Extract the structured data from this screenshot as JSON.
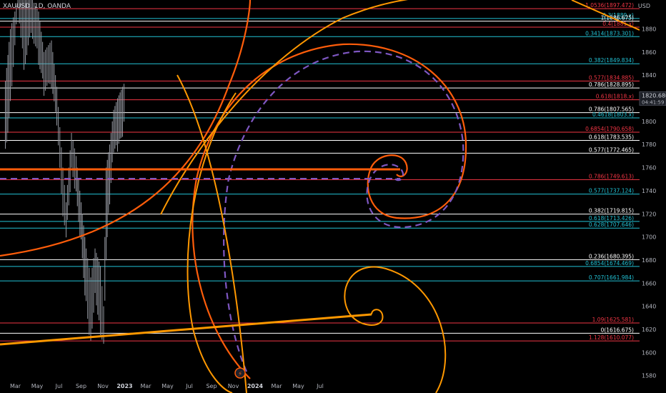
{
  "header": {
    "symbol": "XAUUSD, 1D, OANDA",
    "currency": "USD"
  },
  "price_tag": {
    "value": "1820.680",
    "countdown": "04:41:59"
  },
  "chart_data": {
    "type": "line",
    "title": "",
    "xlabel": "",
    "ylabel": "",
    "ylim": [
      1565,
      1905
    ],
    "y_ticks": [
      1580,
      1600,
      1620,
      1640,
      1660,
      1680,
      1700,
      1720,
      1740,
      1760,
      1780,
      1800,
      1820,
      1840,
      1860,
      1880
    ],
    "x_ticks": [
      "Mar",
      "May",
      "Jul",
      "Sep",
      "Nov",
      "2023",
      "Mar",
      "May",
      "Jul",
      "Sep",
      "Nov",
      "2024",
      "Mar",
      "May",
      "Jul"
    ],
    "colors": {
      "red": "#f23645",
      "cyan": "#22c3d6",
      "white": "#ffffff",
      "orange": "#ff9800",
      "deep_orange": "#ff5d0a",
      "purple": "#7e57c2"
    },
    "fib_levels": [
      {
        "text": "1.0536(1897.472)",
        "price": 1897.472,
        "color": "red"
      },
      {
        "text": "0.3(1889.x)",
        "price": 1889.0,
        "color": "cyan"
      },
      {
        "text": "1(1886.675)",
        "price": 1886.675,
        "color": "white"
      },
      {
        "text": "0.4(1881.x)",
        "price": 1881.5,
        "color": "red"
      },
      {
        "text": "0.3414(1873.301)",
        "price": 1873.301,
        "color": "cyan"
      },
      {
        "text": "0.382(1849.834)",
        "price": 1849.834,
        "color": "cyan"
      },
      {
        "text": "0.577(1834.885)",
        "price": 1834.885,
        "color": "red"
      },
      {
        "text": "0.786(1828.895)",
        "price": 1828.895,
        "color": "white"
      },
      {
        "text": "0.618(1818.x)",
        "price": 1818.7,
        "color": "red"
      },
      {
        "text": "0.786(1807.565)",
        "price": 1807.565,
        "color": "white"
      },
      {
        "text": "0.4618(1803.x)",
        "price": 1803.0,
        "color": "cyan"
      },
      {
        "text": "0.6854(1790.658)",
        "price": 1790.658,
        "color": "red"
      },
      {
        "text": "0.618(1783.535)",
        "price": 1783.535,
        "color": "white"
      },
      {
        "text": "0.577(1772.465)",
        "price": 1772.465,
        "color": "white"
      },
      {
        "text": "0.786(1749.613)",
        "price": 1749.613,
        "color": "red"
      },
      {
        "text": "0.577(1737.124)",
        "price": 1737.124,
        "color": "cyan"
      },
      {
        "text": "0.382(1719.815)",
        "price": 1719.815,
        "color": "white"
      },
      {
        "text": "0.618(1713.426)",
        "price": 1713.426,
        "color": "cyan"
      },
      {
        "text": "0.628(1707.646)",
        "price": 1707.646,
        "color": "cyan"
      },
      {
        "text": "0.236(1680.395)",
        "price": 1680.395,
        "color": "white"
      },
      {
        "text": "0.6854(1674.469)",
        "price": 1674.469,
        "color": "cyan"
      },
      {
        "text": "0.707(1661.984)",
        "price": 1661.984,
        "color": "cyan"
      },
      {
        "text": "1.09(1625.581)",
        "price": 1625.581,
        "color": "red"
      },
      {
        "text": "0(1616.675)",
        "price": 1616.675,
        "color": "white"
      },
      {
        "text": "1.128(1610.077)",
        "price": 1610.077,
        "color": "red"
      }
    ],
    "price_series": [
      {
        "date": "2022-02-01",
        "low": 1785,
        "high": 1835
      },
      {
        "date": "2022-02-15",
        "low": 1830,
        "high": 1880
      },
      {
        "date": "2022-03-08",
        "low": 1900,
        "high": 1905
      },
      {
        "date": "2022-03-25",
        "low": 1860,
        "high": 1905
      },
      {
        "date": "2022-04-18",
        "low": 1880,
        "high": 1905
      },
      {
        "date": "2022-05-05",
        "low": 1860,
        "high": 1895
      },
      {
        "date": "2022-05-20",
        "low": 1830,
        "high": 1860
      },
      {
        "date": "2022-06-10",
        "low": 1835,
        "high": 1870
      },
      {
        "date": "2022-06-25",
        "low": 1800,
        "high": 1830
      },
      {
        "date": "2022-07-12",
        "low": 1720,
        "high": 1760
      },
      {
        "date": "2022-07-21",
        "low": 1700,
        "high": 1730
      },
      {
        "date": "2022-08-05",
        "low": 1760,
        "high": 1790
      },
      {
        "date": "2022-08-18",
        "low": 1740,
        "high": 1770
      },
      {
        "date": "2022-09-01",
        "low": 1700,
        "high": 1730
      },
      {
        "date": "2022-09-15",
        "low": 1650,
        "high": 1690
      },
      {
        "date": "2022-09-28",
        "low": 1620,
        "high": 1665
      },
      {
        "date": "2022-10-10",
        "low": 1660,
        "high": 1690
      },
      {
        "date": "2022-10-25",
        "low": 1630,
        "high": 1675
      },
      {
        "date": "2022-11-03",
        "low": 1616,
        "high": 1640
      },
      {
        "date": "2022-11-10",
        "low": 1700,
        "high": 1760
      },
      {
        "date": "2022-11-20",
        "low": 1740,
        "high": 1780
      },
      {
        "date": "2022-12-01",
        "low": 1780,
        "high": 1810
      },
      {
        "date": "2022-12-12",
        "low": 1780,
        "high": 1820
      },
      {
        "date": "2022-12-26",
        "low": 1790,
        "high": 1830
      },
      {
        "date": "2023-01-03",
        "low": 1810,
        "high": 1835
      }
    ]
  }
}
